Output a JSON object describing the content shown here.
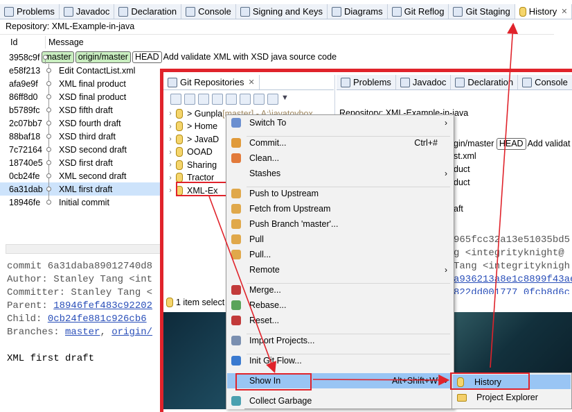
{
  "top_tabs": [
    {
      "label": "Problems",
      "icon": "problems-icon"
    },
    {
      "label": "Javadoc",
      "icon": "javadoc-icon"
    },
    {
      "label": "Declaration",
      "icon": "declaration-icon"
    },
    {
      "label": "Console",
      "icon": "console-icon"
    },
    {
      "label": "Signing and Keys",
      "icon": "signing-icon"
    },
    {
      "label": "Diagrams",
      "icon": "diagrams-icon"
    },
    {
      "label": "Git Reflog",
      "icon": "git-reflog-icon"
    },
    {
      "label": "Git Staging",
      "icon": "git-staging-icon"
    },
    {
      "label": "History",
      "icon": "history-icon",
      "close": "✕"
    }
  ],
  "history": {
    "repository_label": "Repository: XML-Example-in-java",
    "col_id": "Id",
    "col_message": "Message",
    "commits": [
      {
        "id": "3958c9f",
        "msg": "Add validate XML with XSD java source code",
        "badges": [
          "master",
          "origin/master",
          "HEAD"
        ]
      },
      {
        "id": "e58f213",
        "msg": "Edit ContactList.xml"
      },
      {
        "id": "afa9e9f",
        "msg": "XML final product"
      },
      {
        "id": "86ff8d0",
        "msg": "XSD final product"
      },
      {
        "id": "b5789fc",
        "msg": "XSD fifth draft"
      },
      {
        "id": "2c07bb7",
        "msg": "XSD fourth draft"
      },
      {
        "id": "88baf18",
        "msg": "XSD third draft"
      },
      {
        "id": "7c72164",
        "msg": "XSD second draft"
      },
      {
        "id": "18740e5",
        "msg": "XSD first draft"
      },
      {
        "id": "0cb24fe",
        "msg": "XML second draft"
      },
      {
        "id": "6a31dab",
        "msg": "XML first draft",
        "selected": true
      },
      {
        "id": "18946fe",
        "msg": "Initial commit"
      }
    ],
    "details": {
      "commit": "commit 6a31daba89012740d8",
      "author": "Author: Stanley Tang <int",
      "committer": "Committer: Stanley Tang <",
      "parent_label": "Parent: ",
      "parent_link": "18946fef483c92202",
      "child_label": "Child: ",
      "child_link": "0cb24fe881c926cb6",
      "branches_label": "Branches: ",
      "branch1": "master",
      "branch_sep": ", ",
      "branch2": "origin/",
      "message": "XML first draft"
    }
  },
  "inner": {
    "repo_view_title": "Git Repositories",
    "repo_view_close": "✕",
    "inner_tabs": [
      "Problems",
      "Javadoc",
      "Declaration",
      "Console"
    ],
    "tree": [
      {
        "label": "> Gunpla",
        "suffix": " [master] - A:\\javatoybox"
      },
      {
        "label": "> Home"
      },
      {
        "label": "> JavaD"
      },
      {
        "label": "OOAD"
      },
      {
        "label": "Sharing"
      },
      {
        "label": "Tractor"
      },
      {
        "label": "XML-Ex"
      }
    ],
    "status": "1 item select",
    "repo_label_partial": "Repository: XML-Example-in-java",
    "partial_rows": [
      {
        "text": "gin/master",
        "badge": "HEAD",
        "rest": "Add validat"
      },
      {
        "text": "st.xml"
      },
      {
        "text": "duct"
      },
      {
        "text": "duct"
      },
      {
        "text": ""
      },
      {
        "text": "aft"
      }
    ],
    "partial_mono": [
      "965fcc32a13e51035bd5",
      "g <integrityknight@",
      " Tang <integrityknigh",
      "a936213a8e1c8899f43ae",
      "822dd001777 0fcb8d6c"
    ]
  },
  "context_menu": {
    "items": [
      {
        "label": "Switch To",
        "icon": "switch-icon",
        "arrow": "›"
      },
      {
        "sep": true
      },
      {
        "label": "Commit...",
        "icon": "commit-icon",
        "accel": "Ctrl+#"
      },
      {
        "label": "Clean...",
        "icon": "clean-icon"
      },
      {
        "label": "Stashes",
        "icon": "",
        "arrow": "›"
      },
      {
        "sep": true
      },
      {
        "label": "Push to Upstream",
        "icon": "push-icon"
      },
      {
        "label": "Fetch from Upstream",
        "icon": "fetch-icon"
      },
      {
        "label": "Push Branch 'master'...",
        "icon": "push-branch-icon"
      },
      {
        "label": "Pull",
        "icon": "pull-icon"
      },
      {
        "label": "Pull...",
        "icon": "pull-dialog-icon"
      },
      {
        "label": "Remote",
        "icon": "",
        "arrow": "›"
      },
      {
        "sep": true
      },
      {
        "label": "Merge...",
        "icon": "merge-icon"
      },
      {
        "label": "Rebase...",
        "icon": "rebase-icon"
      },
      {
        "label": "Reset...",
        "icon": "reset-icon"
      },
      {
        "sep": true
      },
      {
        "label": "Import Projects...",
        "icon": "import-icon"
      },
      {
        "sep": true
      },
      {
        "label": "Init Git Flow...",
        "icon": "gitflow-icon"
      },
      {
        "sep": true
      },
      {
        "label": "Show In",
        "icon": "",
        "accel": "Alt+Shift+W",
        "arrow": "›",
        "highlight": true
      },
      {
        "sep": true
      },
      {
        "label": "Collect Garbage",
        "icon": "garbage-icon"
      }
    ]
  },
  "submenu": {
    "items": [
      {
        "label": "History",
        "icon": "history-icon",
        "highlight": true
      },
      {
        "label": "Project Explorer",
        "icon": "project-explorer-icon"
      }
    ]
  },
  "colors": {
    "annotation_red": "#e0232b",
    "selection": "#cde3fb",
    "highlight": "#99c5f4"
  }
}
